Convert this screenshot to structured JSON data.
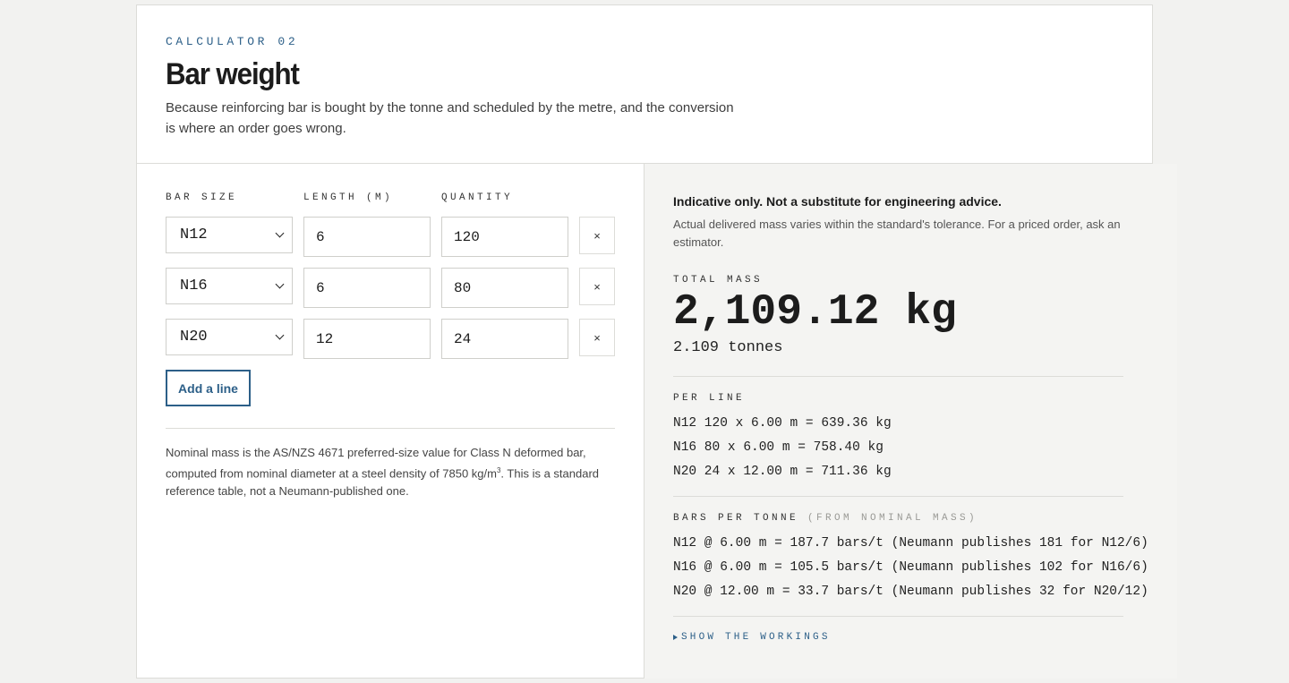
{
  "header": {
    "eyebrow": "CALCULATOR 02",
    "title": "Bar weight",
    "lede": "Because reinforcing bar is bought by the tonne and scheduled by the metre, and the conversion is where an order goes wrong."
  },
  "form": {
    "headers": {
      "bar_size": "BAR SIZE",
      "length": "LENGTH (M)",
      "quantity": "QUANTITY"
    },
    "lines": [
      {
        "bar_size": "N12",
        "length": "6",
        "quantity": "120",
        "remove": "×"
      },
      {
        "bar_size": "N16",
        "length": "6",
        "quantity": "80",
        "remove": "×"
      },
      {
        "bar_size": "N20",
        "length": "12",
        "quantity": "24",
        "remove": "×"
      }
    ],
    "add_label": "Add a line",
    "note_a": "Nominal mass is the AS/NZS 4671 preferred-size value for Class N deformed bar, computed from nominal diameter at a steel density of 7850 kg/m",
    "note_sup": "3",
    "note_b": ". This is a standard reference table, not a Neumann-published one."
  },
  "results": {
    "disclaimer_strong": "Indicative only. Not a substitute for engineering advice.",
    "disclaimer": "Actual delivered mass varies within the standard's tolerance. For a priced order, ask an estimator.",
    "total_label": "TOTAL MASS",
    "total_value": "2,109.12 kg",
    "total_tonnes": "2.109 tonnes",
    "per_line_label": "PER LINE",
    "per_line": [
      "N12 120 x 6.00 m = 639.36 kg",
      "N16 80 x 6.00 m = 758.40 kg",
      "N20 24 x 12.00 m = 711.36 kg"
    ],
    "bars_per_tonne_label": "BARS PER TONNE",
    "bars_per_tonne_sub": "(FROM NOMINAL MASS)",
    "bars_per_tonne": [
      "N12 @ 6.00 m = 187.7 bars/t (Neumann publishes 181 for N12/6)",
      "N16 @ 6.00 m = 105.5 bars/t (Neumann publishes 102 for N16/6)",
      "N20 @ 12.00 m = 33.7 bars/t (Neumann publishes 32 for N20/12)"
    ],
    "show_workings": "SHOW THE WORKINGS"
  },
  "colors": {
    "accent": "#2c5f88",
    "page_bg": "#f2f2f0",
    "panel_bg": "#f4f4f2"
  },
  "icons": {
    "remove": "close-icon",
    "select": "chevron-down-icon",
    "disclosure": "triangle-right-icon"
  }
}
